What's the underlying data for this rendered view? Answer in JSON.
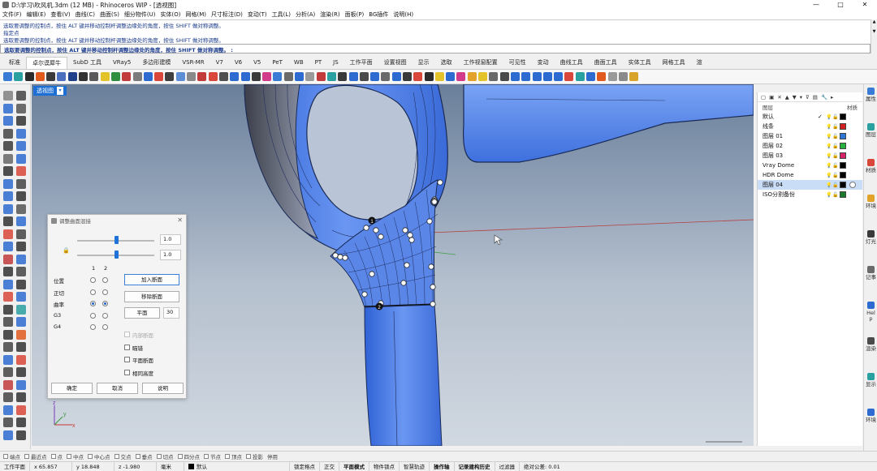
{
  "window": {
    "title": "D:\\学习\\吹风机.3dm (12 MB) - Rhinoceros WIP - [透视图]",
    "controls": [
      "—",
      "□",
      "✕"
    ]
  },
  "menu": [
    "文件(F)",
    "编辑(E)",
    "查看(V)",
    "曲线(C)",
    "曲面(S)",
    "细分物件(U)",
    "实体(O)",
    "网格(M)",
    "尺寸标注(D)",
    "变动(T)",
    "工具(L)",
    "分析(A)",
    "渲染(R)",
    "面板(P)",
    "BG插件",
    "说明(H)"
  ],
  "command_history": [
    "选取要调整的控制点，按住 ALT 键并移动控制杆调整边缘处的角度，按住 SHIFT 做对称调整。",
    "指定点",
    "选取要调整的控制点，按住 ALT 键并移动控制杆调整边缘处的角度，按住 SHIFT 做对称调整。"
  ],
  "command_prompt": "选取要调整的控制点，按住 ALT 键并移动控制杆调整边缘处的角度，按住 SHIFT 做对称调整。 :",
  "tabs": [
    {
      "label": "标准",
      "active": false
    },
    {
      "label": "卓尔谟犀牛",
      "active": true
    },
    {
      "label": "SubD 工具",
      "active": false
    },
    {
      "label": "VRay5",
      "active": false
    },
    {
      "label": "多边形建模",
      "active": false
    },
    {
      "label": "VSR-MR",
      "active": false
    },
    {
      "label": "V7",
      "active": false
    },
    {
      "label": "V6",
      "active": false
    },
    {
      "label": "V5",
      "active": false
    },
    {
      "label": "PeT",
      "active": false
    },
    {
      "label": "WB",
      "active": false
    },
    {
      "label": "PT",
      "active": false
    },
    {
      "label": "JS",
      "active": false
    },
    {
      "label": "工作平面",
      "active": false
    },
    {
      "label": "设置视图",
      "active": false
    },
    {
      "label": "显示",
      "active": false
    },
    {
      "label": "选取",
      "active": false
    },
    {
      "label": "工作视窗配置",
      "active": false
    },
    {
      "label": "可见性",
      "active": false
    },
    {
      "label": "变动",
      "active": false
    },
    {
      "label": "曲线工具",
      "active": false
    },
    {
      "label": "曲面工具",
      "active": false
    },
    {
      "label": "实体工具",
      "active": false
    },
    {
      "label": "网格工具",
      "active": false
    },
    {
      "label": "渲",
      "active": false
    }
  ],
  "toolbar_icon_colors": [
    "#3a7bd5",
    "#2aa0a0",
    "#2b2b2b",
    "#e05a1e",
    "#3a3a3a",
    "#4a6fbf",
    "#1e3f8a",
    "#303030",
    "#5a5a5a",
    "#e3c22a",
    "#2f8f3f",
    "#c23b3b",
    "#7b7b7b",
    "#2e6bd1",
    "#d9463a",
    "#3f3f3f",
    "#5c8fd6",
    "#8a8a8a",
    "#c23b3b",
    "#d9463a",
    "#4f4f4f",
    "#2e6bd1",
    "#2e6bd1",
    "#3a3a3a",
    "#d13b8a",
    "#3a7bd5",
    "#6a6a6a",
    "#2e6bd1",
    "#9a9a9a",
    "#c23b3b",
    "#2aa0a0",
    "#3a3a3a",
    "#2e6bd1",
    "#4a4a4a",
    "#2e6bd1",
    "#6a6a6a",
    "#2e6bd1",
    "#3a3a3a",
    "#d9463a",
    "#2b2b2b",
    "#e3c22a",
    "#2e6bd1",
    "#d13b8a",
    "#e3a32a",
    "#e3c22a",
    "#6a6a6a",
    "#4a4a4a",
    "#2e6bd1",
    "#2e6bd1",
    "#2e6bd1",
    "#2e6bd1",
    "#2e6bd1",
    "#d9463a",
    "#2aa0a0",
    "#2e6bd1",
    "#e05a1e",
    "#9a9a9a",
    "#8a8a8a",
    "#d9a32a"
  ],
  "viewport": {
    "label": "透视图",
    "axis_labels": {
      "z": "z",
      "y": "y",
      "x": "x"
    },
    "point_labels": [
      "1",
      "2"
    ]
  },
  "dialog": {
    "title": "调整曲面混接",
    "slider1_value": "1.0",
    "slider2_value": "1.0",
    "slider1_level": 0.5,
    "slider2_level": 0.5,
    "col1": "1",
    "col2": "2",
    "rows": [
      {
        "label": "位置",
        "r1": false,
        "r2": false
      },
      {
        "label": "正切",
        "r1": false,
        "r2": false
      },
      {
        "label": "曲率",
        "r1": true,
        "r2": true
      },
      {
        "label": "G3",
        "r1": false,
        "r2": false
      },
      {
        "label": "G4",
        "r1": false,
        "r2": false
      }
    ],
    "add_section": "加入断面",
    "remove_section": "移除断面",
    "planar": "平面",
    "planar_value": "30",
    "checks": [
      {
        "label": "内部断面",
        "checked": false,
        "disabled": true
      },
      {
        "label": "瞄错",
        "checked": false,
        "disabled": false
      },
      {
        "label": "平面断面",
        "checked": false,
        "disabled": false
      },
      {
        "label": "相同高度",
        "checked": false,
        "disabled": false
      }
    ],
    "ok": "确定",
    "cancel": "取消",
    "help": "说明"
  },
  "layers_panel": {
    "tool_glyphs": [
      "▢",
      "▣",
      "✕",
      "▲",
      "▼",
      "▾",
      "⊽",
      "▤",
      "🔧",
      "▸"
    ],
    "header_layer": "图层",
    "header_material": "材质",
    "layers": [
      {
        "name": "默认",
        "current": true,
        "color": "#000000",
        "selected": false
      },
      {
        "name": "线条",
        "current": false,
        "color": "#d42020",
        "selected": false
      },
      {
        "name": "图层 01",
        "current": false,
        "color": "#2b78d6",
        "selected": false
      },
      {
        "name": "图层 02",
        "current": false,
        "color": "#27b03c",
        "selected": false
      },
      {
        "name": "图层 03",
        "current": false,
        "color": "#d4226a",
        "selected": false
      },
      {
        "name": "Vray Dome",
        "current": false,
        "color": "#000000",
        "selected": false
      },
      {
        "name": "HDR Dome",
        "current": false,
        "color": "#000000",
        "selected": false
      },
      {
        "name": "图层 04",
        "current": false,
        "color": "#000000",
        "selected": true
      },
      {
        "name": "ISO分割备份",
        "current": false,
        "color": "#1a7a2a",
        "selected": false
      }
    ]
  },
  "side_tabs": [
    "属性",
    "图层",
    "材质",
    "环境",
    "灯光",
    "记事",
    "Help",
    "渲染",
    "显示",
    "环境"
  ],
  "osnaps": [
    "端点",
    "最近点",
    "点",
    "中点",
    "中心点",
    "交点",
    "垂点",
    "切点",
    "四分点",
    "节点",
    "顶点",
    "投影",
    "停用"
  ],
  "status": {
    "cplane": "工作平面",
    "x": "x 65.857",
    "y": "y 18.848",
    "z": "z -1.980",
    "unit": "毫米",
    "layer": "默认",
    "items": [
      "锁定格点",
      "正交",
      "平面模式",
      "物件锁点",
      "智慧轨迹",
      "操作轴",
      "记录建构历史",
      "过滤器"
    ],
    "tolerance": "绝对公差: 0.01"
  }
}
